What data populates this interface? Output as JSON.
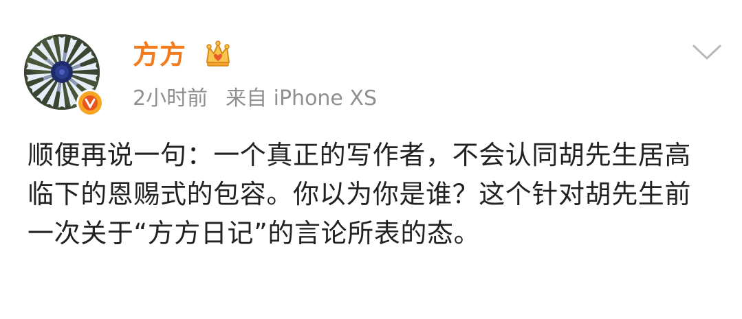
{
  "post": {
    "username": "方方",
    "time": "2小时前",
    "source": "来自 iPhone XS",
    "content": "顺便再说一句：一个真正的写作者，不会认同胡先生居高临下的恩赐式的包容。你以为你是谁？这个针对胡先生前一次关于“方方日记”的言论所表的态。"
  },
  "icons": {
    "avatar": "flower-avatar",
    "verified": "verified-v-badge-icon",
    "member": "crown-member-icon",
    "menu": "chevron-down-icon"
  },
  "colors": {
    "username": "#f37c1e",
    "meta": "#8f8f8f",
    "text": "#222222",
    "badge": "#f6a623"
  }
}
